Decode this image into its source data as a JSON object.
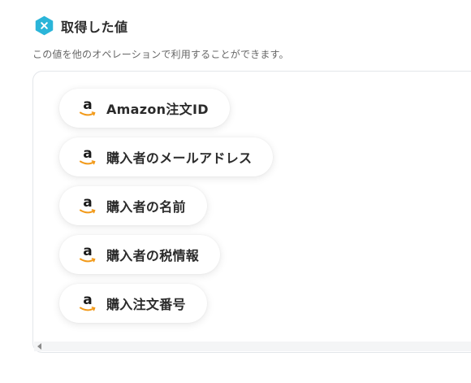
{
  "header": {
    "title": "取得した値",
    "description": "この値を他のオペレーションで利用することができます。",
    "badge_icon": "x-hexagon-icon",
    "badge_color": "#2bb5d9"
  },
  "values": [
    {
      "label": "Amazon注文ID",
      "icon": "amazon-icon"
    },
    {
      "label": "購入者のメールアドレス",
      "icon": "amazon-icon"
    },
    {
      "label": "購入者の名前",
      "icon": "amazon-icon"
    },
    {
      "label": "購入者の税情報",
      "icon": "amazon-icon"
    },
    {
      "label": "購入注文番号",
      "icon": "amazon-icon"
    }
  ],
  "colors": {
    "amazon_smile": "#f29a1a",
    "text": "#2b2b2b",
    "muted": "#666666"
  }
}
